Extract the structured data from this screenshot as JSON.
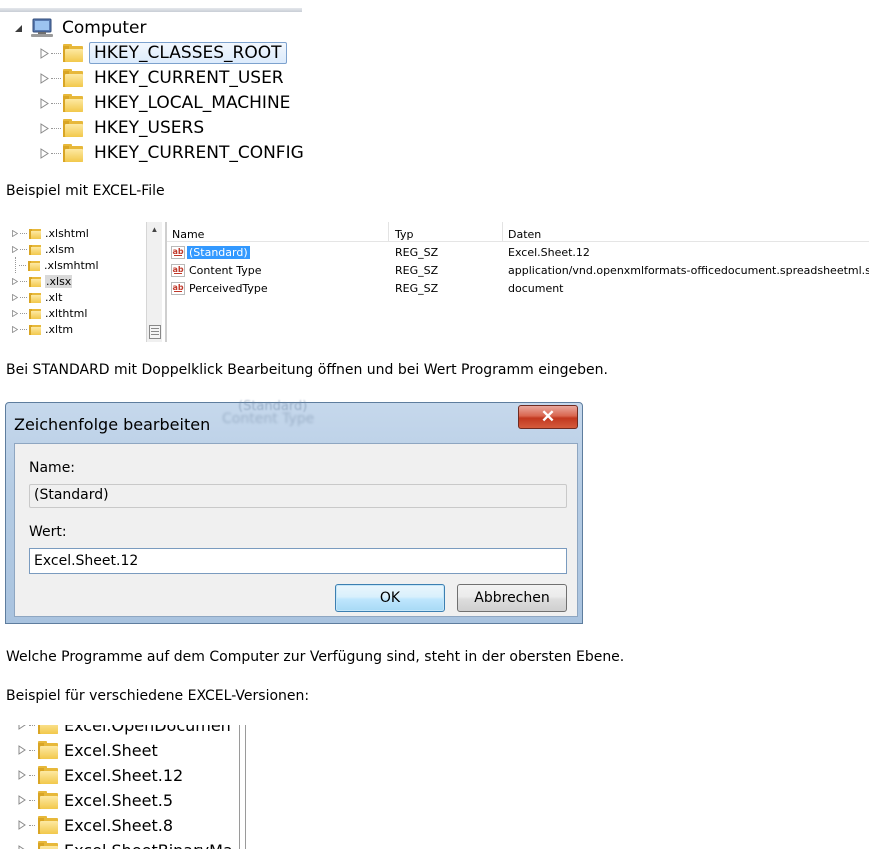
{
  "top_tree": {
    "root_label": "Computer",
    "root_icon": "computer-icon",
    "hives": [
      {
        "label": "HKEY_CLASSES_ROOT",
        "selected": true
      },
      {
        "label": "HKEY_CURRENT_USER",
        "selected": false
      },
      {
        "label": "HKEY_LOCAL_MACHINE",
        "selected": false
      },
      {
        "label": "HKEY_USERS",
        "selected": false
      },
      {
        "label": "HKEY_CURRENT_CONFIG",
        "selected": false
      }
    ]
  },
  "text": {
    "example_excel": "Beispiel mit EXCEL-File",
    "instruction": "Bei STANDARD mit Doppelklick Bearbeitung öffnen und bei Wert Programm eingeben.",
    "programs_note": "Welche Programme auf dem Computer zur Verfügung sind, steht in der obersten Ebene.",
    "versions_example": "Beispiel für verschiedene EXCEL-Versionen:"
  },
  "registry_panel": {
    "keys": [
      ".xlshtml",
      ".xlsm",
      ".xlsmhtml",
      ".xlsx",
      ".xlt",
      ".xlthtml",
      ".xltm"
    ],
    "selected_key": ".xlsx",
    "columns": {
      "name": "Name",
      "type": "Typ",
      "data": "Daten"
    },
    "values": [
      {
        "name": "(Standard)",
        "type": "REG_SZ",
        "data": "Excel.Sheet.12",
        "selected": true
      },
      {
        "name": "Content Type",
        "type": "REG_SZ",
        "data": "application/vnd.openxmlformats-officedocument.spreadsheetml.sheet",
        "selected": false
      },
      {
        "name": "PerceivedType",
        "type": "REG_SZ",
        "data": "document",
        "selected": false
      }
    ]
  },
  "dialog": {
    "title": "Zeichenfolge bearbeiten",
    "ghost_behind_title": "Content Type",
    "ghost_top": "(Standard)",
    "close_label": "✕",
    "name_label": "Name:",
    "name_value": "(Standard)",
    "value_label": "Wert:",
    "value_input": "Excel.Sheet.12",
    "ok_label": "OK",
    "cancel_label": "Abbrechen"
  },
  "bottom_tree": {
    "items": [
      "Excel.OpenDocumen",
      "Excel.Sheet",
      "Excel.Sheet.12",
      "Excel.Sheet.5",
      "Excel.Sheet.8",
      "Excel.SheetBinaryMa"
    ]
  },
  "colors": {
    "folder": "#e7b83a",
    "selection": "#3399ff",
    "close_button": "#c2381f"
  }
}
